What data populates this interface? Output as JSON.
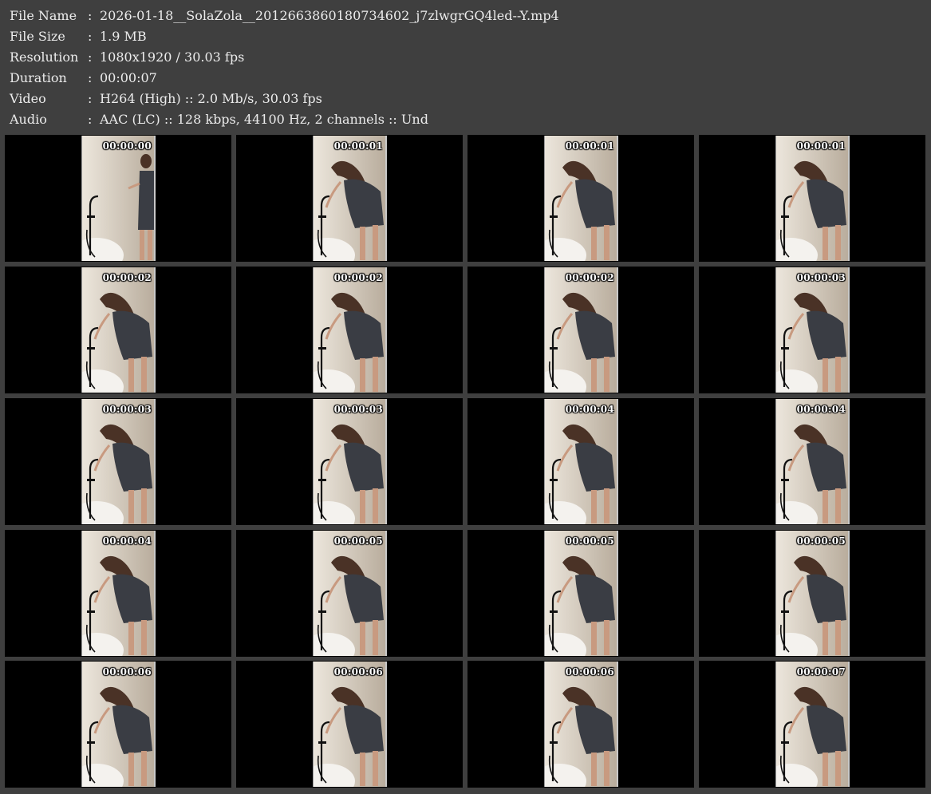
{
  "info": [
    {
      "label": "File Name",
      "value": "2026-01-18__SolaZola__2012663860180734602_j7zlwgrGQ4led--Y.mp4"
    },
    {
      "label": "File Size",
      "value": "1.9 MB"
    },
    {
      "label": "Resolution",
      "value": "1080x1920 / 30.03 fps"
    },
    {
      "label": "Duration",
      "value": "00:00:07"
    },
    {
      "label": "Video",
      "value": "H264 (High) :: 2.0 Mb/s, 30.03 fps"
    },
    {
      "label": "Audio",
      "value": "AAC (LC) :: 128 kbps, 44100 Hz, 2 channels :: Und"
    }
  ],
  "separator": ":",
  "thumbnails": [
    "00:00:00",
    "00:00:01",
    "00:00:01",
    "00:00:01",
    "00:00:02",
    "00:00:02",
    "00:00:02",
    "00:00:03",
    "00:00:03",
    "00:00:03",
    "00:00:04",
    "00:00:04",
    "00:00:04",
    "00:00:05",
    "00:00:05",
    "00:00:05",
    "00:00:06",
    "00:00:06",
    "00:00:06",
    "00:00:07"
  ],
  "colors": {
    "background": "#3f3f3f",
    "text": "#ececec",
    "cell": "#000000",
    "wall": "#d8d0c4",
    "dress": "#3a3d44",
    "hair": "#4a3226",
    "skin": "#c89a80"
  }
}
